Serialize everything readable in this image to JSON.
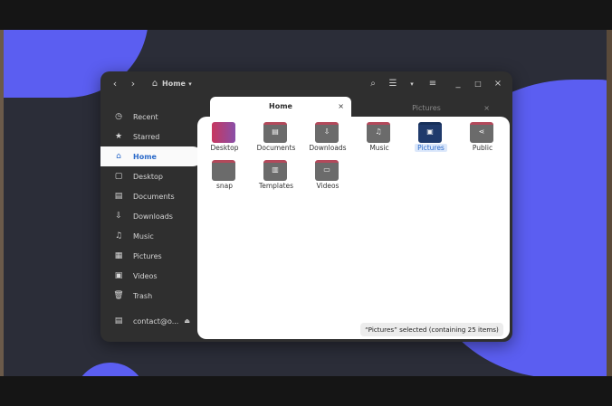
{
  "header": {
    "location_label": "Home",
    "back_icon": "chevron-left-icon",
    "forward_icon": "chevron-right-icon",
    "home_icon": "home-icon",
    "dropdown_icon": "caret-down-icon",
    "search_icon": "search-icon",
    "view_icon": "list-view-icon",
    "menu_icon": "hamburger-menu-icon",
    "minimize": "_",
    "maximize": "□",
    "close": "×"
  },
  "tabs": [
    {
      "label": "Home",
      "close": "×"
    },
    {
      "label": "Pictures",
      "close": "×"
    }
  ],
  "sidebar": {
    "items": [
      {
        "label": "Recent",
        "icon": "◷"
      },
      {
        "label": "Starred",
        "icon": "★"
      },
      {
        "label": "Home",
        "icon": "⌂"
      },
      {
        "label": "Desktop",
        "icon": "▢"
      },
      {
        "label": "Documents",
        "icon": "▤"
      },
      {
        "label": "Downloads",
        "icon": "⇩"
      },
      {
        "label": "Music",
        "icon": "♫"
      },
      {
        "label": "Pictures",
        "icon": "▦"
      },
      {
        "label": "Videos",
        "icon": "▣"
      },
      {
        "label": "Trash",
        "icon": "🗑"
      },
      {
        "label": "contact@o...",
        "icon": "▤",
        "eject": "⏏"
      }
    ]
  },
  "files": [
    {
      "name": "Desktop",
      "glyph": ""
    },
    {
      "name": "Documents",
      "glyph": "▤"
    },
    {
      "name": "Downloads",
      "glyph": "⇩"
    },
    {
      "name": "Music",
      "glyph": "♫"
    },
    {
      "name": "Pictures",
      "glyph": "▣"
    },
    {
      "name": "Public",
      "glyph": "⋖"
    },
    {
      "name": "snap",
      "glyph": ""
    },
    {
      "name": "Templates",
      "glyph": "▥"
    },
    {
      "name": "Videos",
      "glyph": "▭"
    }
  ],
  "status_text": "“Pictures” selected  (containing 25 items)",
  "colors": {
    "accent": "#2b6ac9",
    "wallpaper_blob": "#5b5ef1",
    "folder_tab": "#b3495b"
  }
}
